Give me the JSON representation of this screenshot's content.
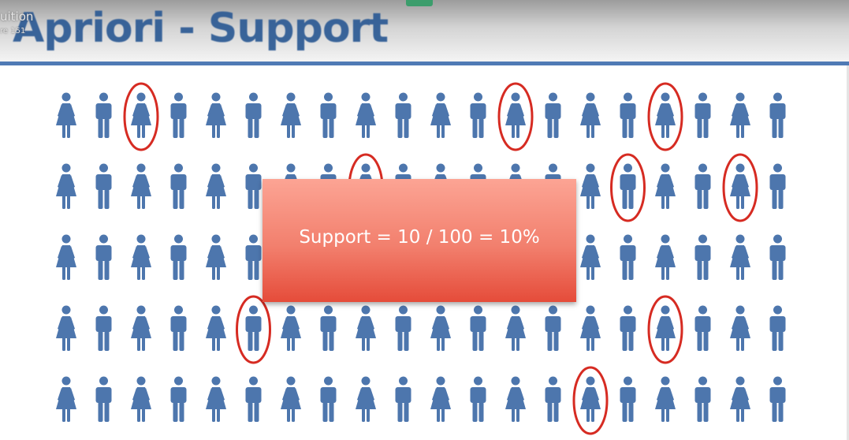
{
  "slide": {
    "title": "Apriori - Support",
    "result_text": "Support = 10 / 100 = 10%"
  },
  "video_overlay": {
    "title": "uition",
    "subtitle": "re 151"
  },
  "people_grid": {
    "rows": 5,
    "columns": 20,
    "total": 100,
    "highlighted_count": 10,
    "figure_color": "#4d76ad",
    "highlight_color": "#d62b22",
    "gender_pattern": [
      [
        "f",
        "m",
        "f",
        "m",
        "f",
        "m",
        "f",
        "m",
        "f",
        "m",
        "f",
        "m",
        "f",
        "m",
        "f",
        "m",
        "f",
        "m",
        "f",
        "m"
      ],
      [
        "f",
        "m",
        "f",
        "m",
        "f",
        "m",
        "f",
        "m",
        "f",
        "m",
        "f",
        "m",
        "f",
        "m",
        "f",
        "m",
        "f",
        "m",
        "f",
        "m"
      ],
      [
        "f",
        "m",
        "f",
        "m",
        "f",
        "m",
        "f",
        "m",
        "f",
        "m",
        "f",
        "m",
        "f",
        "m",
        "f",
        "m",
        "f",
        "m",
        "f",
        "m"
      ],
      [
        "f",
        "m",
        "f",
        "m",
        "f",
        "m",
        "f",
        "m",
        "f",
        "m",
        "f",
        "m",
        "f",
        "m",
        "f",
        "m",
        "f",
        "m",
        "f",
        "m"
      ],
      [
        "f",
        "m",
        "f",
        "m",
        "f",
        "m",
        "f",
        "m",
        "f",
        "m",
        "f",
        "m",
        "f",
        "m",
        "f",
        "m",
        "f",
        "m",
        "f",
        "m"
      ]
    ],
    "highlighted": [
      [
        0,
        2
      ],
      [
        0,
        12
      ],
      [
        0,
        16
      ],
      [
        1,
        8
      ],
      [
        1,
        15
      ],
      [
        1,
        18
      ],
      [
        3,
        5
      ],
      [
        3,
        16
      ],
      [
        4,
        14
      ]
    ]
  }
}
